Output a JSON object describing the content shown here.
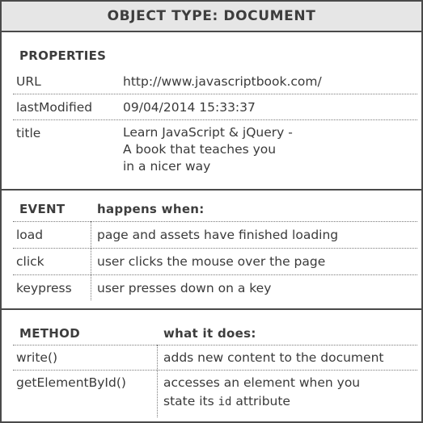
{
  "title": "OBJECT TYPE: DOCUMENT",
  "properties": {
    "heading": "PROPERTIES",
    "rows": [
      {
        "name": "URL",
        "value_lines": [
          "http://www.javascriptbook.com/"
        ]
      },
      {
        "name": "lastModified",
        "value_lines": [
          "09/04/2014 15:33:37"
        ]
      },
      {
        "name": "title",
        "value_lines": [
          "Learn JavaScript & jQuery -",
          "A book that teaches you",
          "in a nicer way"
        ]
      }
    ]
  },
  "events": {
    "heading": "EVENT",
    "subheading": "happens when:",
    "rows": [
      {
        "name": "load",
        "description": "page and assets have finished loading"
      },
      {
        "name": "click",
        "description": "user clicks the mouse over the page"
      },
      {
        "name": "keypress",
        "description": "user presses down on a key"
      }
    ]
  },
  "methods": {
    "heading": "METHOD",
    "subheading": "what it does:",
    "rows": [
      {
        "name": "write()",
        "description_lines": [
          "adds new content to the document"
        ]
      },
      {
        "name": "getElementById()",
        "description_lines": [
          "accesses an element when you",
          "state its id attribute"
        ]
      }
    ],
    "code_word": "id"
  }
}
